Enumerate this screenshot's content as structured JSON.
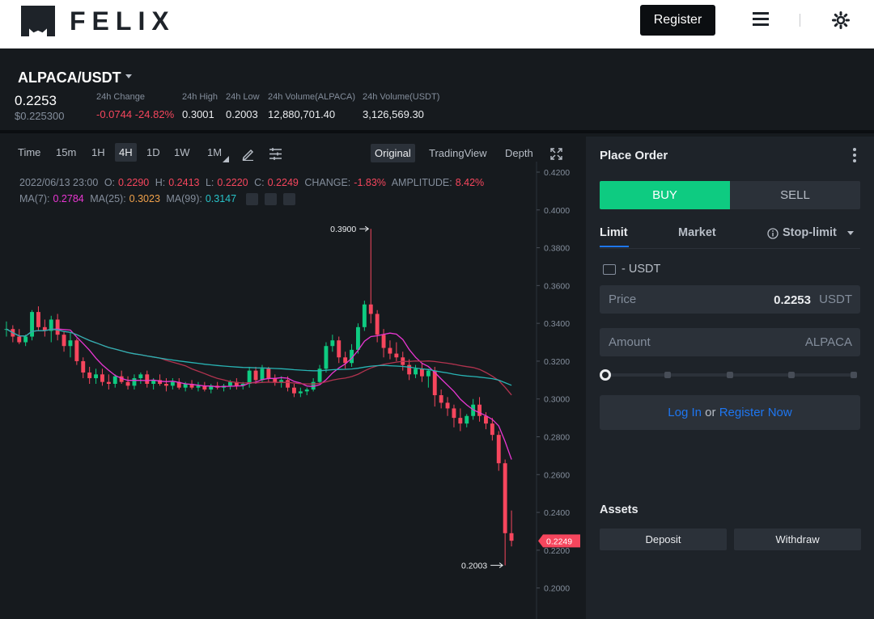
{
  "header": {
    "logo_text": "FELIX",
    "register_label": "Register"
  },
  "ticker": {
    "pair": "ALPACA/USDT",
    "last_price": "0.2253",
    "last_price_usd": "$0.225300",
    "change_label": "24h Change",
    "change_value": "-0.0744 -24.82%",
    "high_label": "24h High",
    "high_value": "0.3001",
    "low_label": "24h Low",
    "low_value": "0.2003",
    "vol_base_label": "24h Volume(ALPACA)",
    "vol_base_value": "12,880,701.40",
    "vol_quote_label": "24h Volume(USDT)",
    "vol_quote_value": "3,126,569.30"
  },
  "chart_toolbar": {
    "timeframes": [
      "Time",
      "15m",
      "1H",
      "4H",
      "1D",
      "1W",
      "1M"
    ],
    "active_timeframe": "4H",
    "views": [
      "Original",
      "TradingView",
      "Depth"
    ],
    "active_view": "Original"
  },
  "chart_info": {
    "datetime": "2022/06/13 23:00",
    "o_label": "O:",
    "o": "0.2290",
    "h_label": "H:",
    "h": "0.2413",
    "l_label": "L:",
    "l": "0.2220",
    "c_label": "C:",
    "c": "0.2249",
    "change_label": "CHANGE:",
    "change": "-1.83%",
    "amplitude_label": "AMPLITUDE:",
    "amplitude": "8.42%",
    "ma7_label": "MA(7):",
    "ma7": "0.2784",
    "ma25_label": "MA(25):",
    "ma25": "0.3023",
    "ma99_label": "MA(99):",
    "ma99": "0.3147"
  },
  "chart_data": {
    "type": "candlestick",
    "y_ticks": [
      "0.4200",
      "0.4000",
      "0.3800",
      "0.3600",
      "0.3400",
      "0.3200",
      "0.3000",
      "0.2800",
      "0.2600",
      "0.2400",
      "0.2200",
      "0.2000"
    ],
    "ylim": [
      0.196,
      0.42
    ],
    "high_marker": "0.3900",
    "low_marker": "0.2003",
    "current_price_tag": "0.2249",
    "colors": {
      "up": "#0ecb81",
      "down": "#f6465d",
      "ma7": "#e936d2",
      "ma25": "#b2334f",
      "ma99": "#28b4b4"
    },
    "candles": [
      [
        0.337,
        0.341,
        0.333,
        0.337
      ],
      [
        0.337,
        0.339,
        0.33,
        0.333
      ],
      [
        0.333,
        0.337,
        0.329,
        0.33
      ],
      [
        0.33,
        0.334,
        0.328,
        0.333
      ],
      [
        0.333,
        0.347,
        0.331,
        0.346
      ],
      [
        0.346,
        0.349,
        0.336,
        0.338
      ],
      [
        0.338,
        0.342,
        0.333,
        0.336
      ],
      [
        0.336,
        0.344,
        0.33,
        0.342
      ],
      [
        0.342,
        0.345,
        0.331,
        0.334
      ],
      [
        0.334,
        0.336,
        0.325,
        0.328
      ],
      [
        0.328,
        0.335,
        0.322,
        0.331
      ],
      [
        0.331,
        0.332,
        0.318,
        0.32
      ],
      [
        0.32,
        0.322,
        0.311,
        0.314
      ],
      [
        0.314,
        0.317,
        0.308,
        0.311
      ],
      [
        0.311,
        0.316,
        0.308,
        0.313
      ],
      [
        0.313,
        0.316,
        0.307,
        0.309
      ],
      [
        0.309,
        0.313,
        0.305,
        0.308
      ],
      [
        0.308,
        0.313,
        0.306,
        0.312
      ],
      [
        0.312,
        0.315,
        0.308,
        0.309
      ],
      [
        0.309,
        0.312,
        0.305,
        0.307
      ],
      [
        0.307,
        0.313,
        0.305,
        0.311
      ],
      [
        0.311,
        0.314,
        0.308,
        0.313
      ],
      [
        0.313,
        0.315,
        0.306,
        0.308
      ],
      [
        0.308,
        0.311,
        0.305,
        0.31
      ],
      [
        0.31,
        0.313,
        0.307,
        0.308
      ],
      [
        0.308,
        0.311,
        0.304,
        0.307
      ],
      [
        0.307,
        0.311,
        0.305,
        0.309
      ],
      [
        0.309,
        0.311,
        0.305,
        0.306
      ],
      [
        0.306,
        0.309,
        0.304,
        0.308
      ],
      [
        0.308,
        0.31,
        0.305,
        0.306
      ],
      [
        0.306,
        0.309,
        0.304,
        0.307
      ],
      [
        0.307,
        0.309,
        0.304,
        0.305
      ],
      [
        0.305,
        0.308,
        0.303,
        0.307
      ],
      [
        0.307,
        0.309,
        0.305,
        0.306
      ],
      [
        0.306,
        0.308,
        0.304,
        0.307
      ],
      [
        0.307,
        0.31,
        0.305,
        0.309
      ],
      [
        0.309,
        0.311,
        0.305,
        0.307
      ],
      [
        0.307,
        0.309,
        0.305,
        0.308
      ],
      [
        0.308,
        0.317,
        0.306,
        0.315
      ],
      [
        0.315,
        0.317,
        0.308,
        0.31
      ],
      [
        0.31,
        0.318,
        0.309,
        0.316
      ],
      [
        0.316,
        0.317,
        0.309,
        0.311
      ],
      [
        0.311,
        0.313,
        0.307,
        0.309
      ],
      [
        0.309,
        0.312,
        0.306,
        0.31
      ],
      [
        0.31,
        0.312,
        0.304,
        0.306
      ],
      [
        0.306,
        0.308,
        0.301,
        0.303
      ],
      [
        0.303,
        0.306,
        0.301,
        0.304
      ],
      [
        0.304,
        0.306,
        0.302,
        0.305
      ],
      [
        0.305,
        0.311,
        0.304,
        0.309
      ],
      [
        0.309,
        0.318,
        0.308,
        0.316
      ],
      [
        0.316,
        0.33,
        0.314,
        0.328
      ],
      [
        0.328,
        0.334,
        0.325,
        0.331
      ],
      [
        0.331,
        0.333,
        0.319,
        0.322
      ],
      [
        0.322,
        0.325,
        0.316,
        0.319
      ],
      [
        0.319,
        0.329,
        0.317,
        0.326
      ],
      [
        0.326,
        0.34,
        0.324,
        0.338
      ],
      [
        0.338,
        0.352,
        0.336,
        0.35
      ],
      [
        0.35,
        0.39,
        0.34,
        0.345
      ],
      [
        0.345,
        0.347,
        0.33,
        0.334
      ],
      [
        0.334,
        0.337,
        0.322,
        0.327
      ],
      [
        0.327,
        0.331,
        0.321,
        0.324
      ],
      [
        0.324,
        0.33,
        0.32,
        0.322
      ],
      [
        0.322,
        0.325,
        0.315,
        0.318
      ],
      [
        0.318,
        0.321,
        0.31,
        0.313
      ],
      [
        0.313,
        0.318,
        0.311,
        0.316
      ],
      [
        0.316,
        0.319,
        0.309,
        0.312
      ],
      [
        0.312,
        0.316,
        0.306,
        0.315
      ],
      [
        0.315,
        0.317,
        0.296,
        0.302
      ],
      [
        0.302,
        0.305,
        0.295,
        0.298
      ],
      [
        0.298,
        0.301,
        0.291,
        0.295
      ],
      [
        0.295,
        0.297,
        0.285,
        0.29
      ],
      [
        0.29,
        0.295,
        0.283,
        0.287
      ],
      [
        0.287,
        0.292,
        0.285,
        0.291
      ],
      [
        0.291,
        0.3,
        0.289,
        0.297
      ],
      [
        0.297,
        0.301,
        0.288,
        0.291
      ],
      [
        0.291,
        0.293,
        0.284,
        0.287
      ],
      [
        0.287,
        0.29,
        0.278,
        0.281
      ],
      [
        0.281,
        0.283,
        0.262,
        0.266
      ],
      [
        0.266,
        0.268,
        0.212,
        0.229
      ],
      [
        0.229,
        0.241,
        0.222,
        0.225
      ]
    ]
  },
  "order": {
    "title": "Place Order",
    "buy_label": "BUY",
    "sell_label": "SELL",
    "tabs": [
      "Limit",
      "Market",
      "Stop-limit"
    ],
    "active_tab": "Limit",
    "balance": "- USDT",
    "price_label": "Price",
    "price_value": "0.2253",
    "price_unit": "USDT",
    "amount_label": "Amount",
    "amount_unit": "ALPACA",
    "slider_percent": 0,
    "login_text": "Log In",
    "or_text": "or",
    "register_text": "Register Now"
  },
  "assets": {
    "title": "Assets",
    "deposit_label": "Deposit",
    "withdraw_label": "Withdraw"
  }
}
